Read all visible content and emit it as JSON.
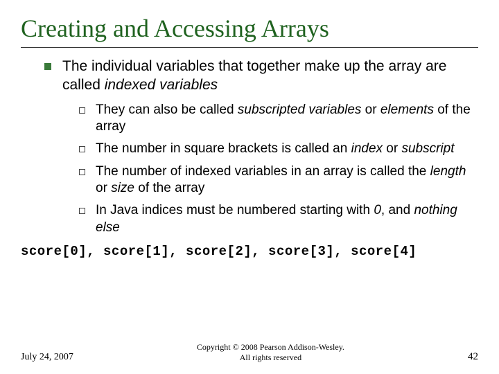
{
  "title": "Creating and Accessing Arrays",
  "bullet1": {
    "pre": "The individual variables that together make up the array are called ",
    "em": "indexed variables"
  },
  "sub": [
    {
      "p1": "They can also be called ",
      "em1": "subscripted variables",
      "p2": " or ",
      "em2": "elements",
      "p3": " of the array"
    },
    {
      "p1": "The number in square brackets is called an ",
      "em1": "index",
      "p2": " or ",
      "em2": "subscript",
      "p3": ""
    },
    {
      "p1": "The number of indexed variables in an array is called the ",
      "em1": "length",
      "p2": " or ",
      "em2": "size",
      "p3": " of the array"
    },
    {
      "p1": "In Java indices must be numbered starting with ",
      "em1": "0",
      "p2": ", and ",
      "em2": "nothing else",
      "p3": ""
    }
  ],
  "code": "score[0], score[1], score[2], score[3], score[4]",
  "footer": {
    "date": "July 24, 2007",
    "copyright_l1": "Copyright © 2008 Pearson Addison-Wesley.",
    "copyright_l2": "All rights reserved",
    "page": "42"
  }
}
